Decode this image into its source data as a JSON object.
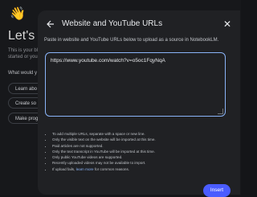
{
  "background": {
    "avatar_icon": "waving-hand-emoji",
    "heading": "Let's s",
    "lines": [
      "This is your bl",
      "started or you"
    ],
    "question": "What would y",
    "options": [
      "Learn abo",
      "Create so",
      "Make prog"
    ]
  },
  "modal": {
    "title": "Website and YouTube URLs",
    "subtitle": "Paste in website and YouTube URLs below to upload as a source in NotebookLM.",
    "url_value": "https://www.youtube.com/watch?v=o5oc1FqyNqA",
    "notes": [
      "To add multiple URLs, separate with a space or new line.",
      "Only the visible text on the website will be imported at this time.",
      "Paid articles are not supported.",
      "Only the text transcript in YouTube will be imported at this time.",
      "Only public YouTube videos are supported.",
      "Recently uploaded videos may not be available to import."
    ],
    "last_note_prefix": "If upload fails,",
    "last_note_link": "learn more",
    "last_note_suffix": "for common reasons.",
    "insert_label": "Insert",
    "accent_color": "#4a5cff"
  }
}
